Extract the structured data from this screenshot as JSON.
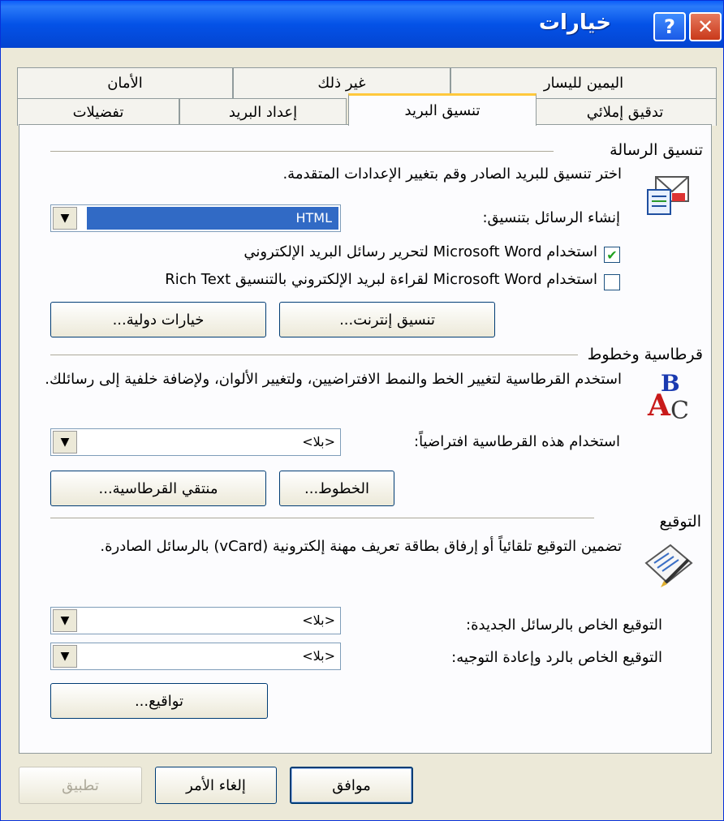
{
  "window": {
    "title": "خيارات"
  },
  "tabs_top": [
    {
      "label": "اليمين لليسار"
    },
    {
      "label": "غير ذلك"
    },
    {
      "label": "الأمان"
    }
  ],
  "tabs_bottom": [
    {
      "label": "تدقيق إملائي"
    },
    {
      "label": "تنسيق البريد"
    },
    {
      "label": "إعداد البريد"
    },
    {
      "label": "تفضيلات"
    }
  ],
  "message_format": {
    "title": "تنسيق الرسالة",
    "description": "اختر تنسيق للبريد الصادر وقم بتغيير الإعدادات المتقدمة.",
    "compose_label": "إنشاء الرسائل بتنسيق:",
    "compose_value": "HTML",
    "use_word_edit": "استخدام Microsoft Word لتحرير رسائل البريد الإلكتروني",
    "use_word_read": "استخدام Microsoft Word لقراءة لبريد الإلكتروني بالتنسيق Rich Text",
    "internet_format_button": "تنسيق إنترنت...",
    "international_options_button": "خيارات دولية..."
  },
  "stationery": {
    "title": "قرطاسية وخطوط",
    "description": "استخدم القرطاسية لتغيير الخط والنمط الافتراضيين، ولتغيير الألوان، ولإضافة خلفية إلى رسائلك.",
    "default_label": "استخدام هذه القرطاسية افتراضياً:",
    "default_value": "<بلا>",
    "fonts_button": "الخطوط...",
    "picker_button": "منتقي القرطاسية..."
  },
  "signature": {
    "title": "التوقيع",
    "description": "تضمين التوقيع تلقائياً أو إرفاق بطاقة تعريف مهنة إلكترونية (vCard) بالرسائل الصادرة.",
    "new_label": "التوقيع الخاص بالرسائل الجديدة:",
    "new_value": "<بلا>",
    "reply_label": "التوقيع الخاص بالرد وإعادة التوجيه:",
    "reply_value": "<بلا>",
    "signatures_button": "تواقيع..."
  },
  "footer": {
    "ok": "موافق",
    "cancel": "إلغاء الأمر",
    "apply": "تطبيق"
  }
}
